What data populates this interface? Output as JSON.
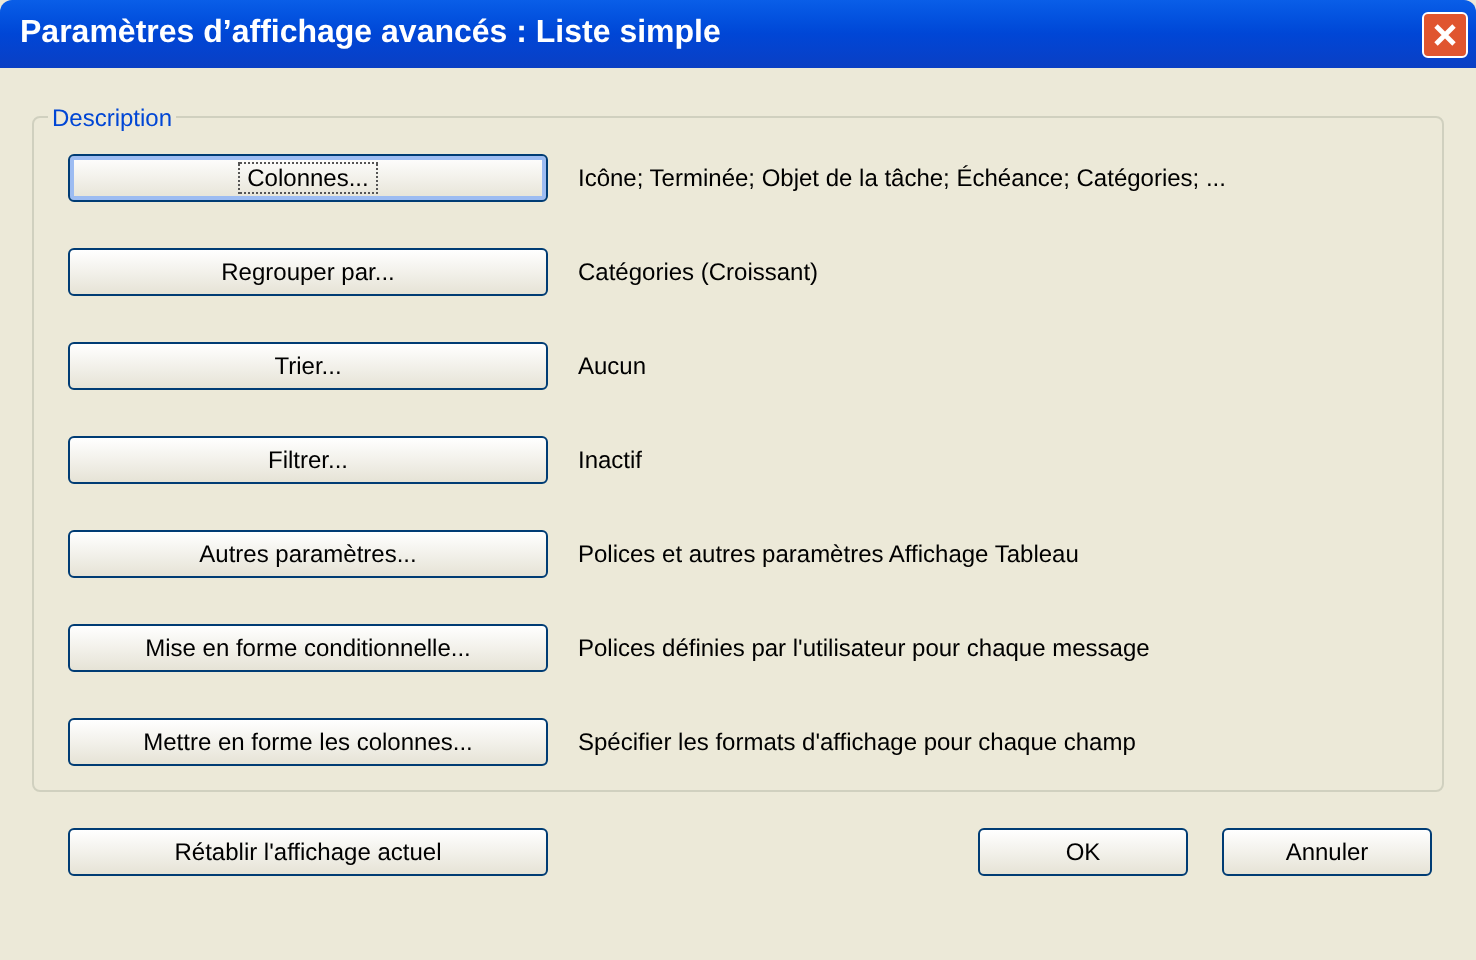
{
  "window": {
    "title": "Paramètres d’affichage avancés : Liste simple"
  },
  "group": {
    "label": "Description",
    "rows": [
      {
        "button": "Colonnes...",
        "focused": true,
        "description": "Icône; Terminée; Objet de la tâche; Échéance; Catégories; ..."
      },
      {
        "button": "Regrouper par...",
        "focused": false,
        "description": "Catégories (Croissant)"
      },
      {
        "button": "Trier...",
        "focused": false,
        "description": "Aucun"
      },
      {
        "button": "Filtrer...",
        "focused": false,
        "description": "Inactif"
      },
      {
        "button": "Autres paramètres...",
        "focused": false,
        "description": "Polices et autres paramètres Affichage Tableau"
      },
      {
        "button": "Mise en forme conditionnelle...",
        "focused": false,
        "description": "Polices définies par l'utilisateur pour chaque message"
      },
      {
        "button": "Mettre en forme les colonnes...",
        "focused": false,
        "description": "Spécifier les formats d'affichage pour chaque champ"
      }
    ]
  },
  "footer": {
    "reset_button": {
      "label": "Rétablir l'affichage actuel"
    },
    "buttons": [
      "OK",
      "Annuler"
    ]
  }
}
